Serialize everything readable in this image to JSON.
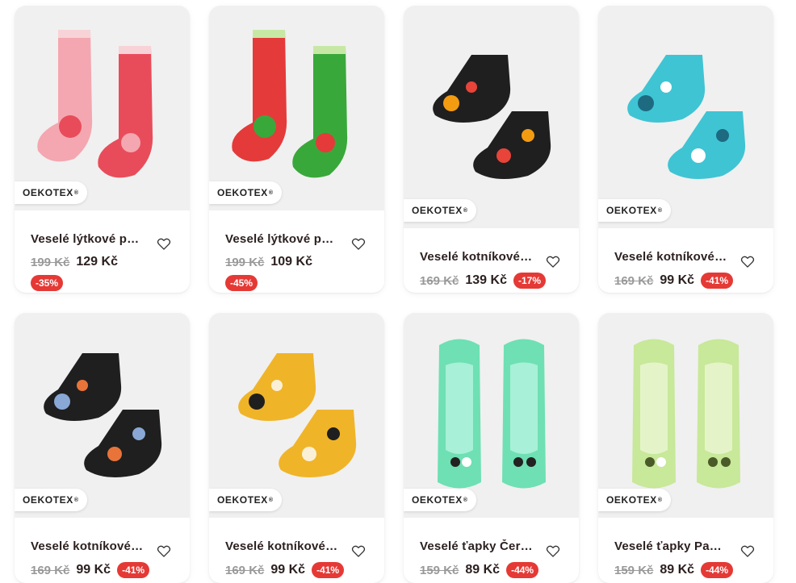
{
  "badge_label": "OEKOTEX",
  "badge_mark": "®",
  "products": [
    {
      "title": "Veselé lýtkové ponožky Jahody",
      "old_price": "199 Kč",
      "new_price": "129 Kč",
      "discount": "-35%",
      "icon": "strawberry-socks-image",
      "colors": {
        "a": "#f4a7b0",
        "b": "#e84c5a",
        "c": "#f7d3d7"
      }
    },
    {
      "title": "Veselé lýtkové ponožky Melouny",
      "old_price": "199 Kč",
      "new_price": "109 Kč",
      "discount": "-45%",
      "icon": "watermelon-socks-image",
      "colors": {
        "a": "#e53a3a",
        "b": "#39a83a",
        "c": "#c7e8a5"
      }
    },
    {
      "title": "Veselé kotníkové ponožky Květiny",
      "old_price": "169 Kč",
      "new_price": "139 Kč",
      "discount": "-17%",
      "icon": "flower-ankle-socks-image",
      "colors": {
        "a": "#1f1f1f",
        "b": "#f39c12",
        "c": "#e8443a"
      }
    },
    {
      "title": "Veselé kotníkové ponožky Kopretiny",
      "old_price": "169 Kč",
      "new_price": "99 Kč",
      "discount": "-41%",
      "icon": "daisy-ankle-socks-image",
      "colors": {
        "a": "#3fc4d4",
        "b": "#1e6a80",
        "c": "#ffffff"
      }
    },
    {
      "title": "Veselé kotníkové ponožky Louka",
      "old_price": "169 Kč",
      "new_price": "99 Kč",
      "discount": "-41%",
      "icon": "meadow-ankle-socks-image",
      "colors": {
        "a": "#1f1f1f",
        "b": "#8aa8d6",
        "c": "#e8743a"
      }
    },
    {
      "title": "Veselé kotníkové ponožky Pivo",
      "old_price": "169 Kč",
      "new_price": "99 Kč",
      "discount": "-41%",
      "icon": "beer-ankle-socks-image",
      "colors": {
        "a": "#f0b429",
        "b": "#1f1f1f",
        "c": "#faf0d7"
      }
    },
    {
      "title": "Veselé ťapky Černá ovce",
      "old_price": "159 Kč",
      "new_price": "89 Kč",
      "discount": "-44%",
      "icon": "sheep-footie-socks-image",
      "colors": {
        "a": "#6ee0b4",
        "b": "#a8f0d8",
        "c": "#222222"
      }
    },
    {
      "title": "Veselé ťapky Pandy v bambusu",
      "old_price": "159 Kč",
      "new_price": "89 Kč",
      "discount": "-44%",
      "icon": "panda-footie-socks-image",
      "colors": {
        "a": "#c8e89a",
        "b": "#e4f4c8",
        "c": "#4a5a28"
      }
    }
  ]
}
